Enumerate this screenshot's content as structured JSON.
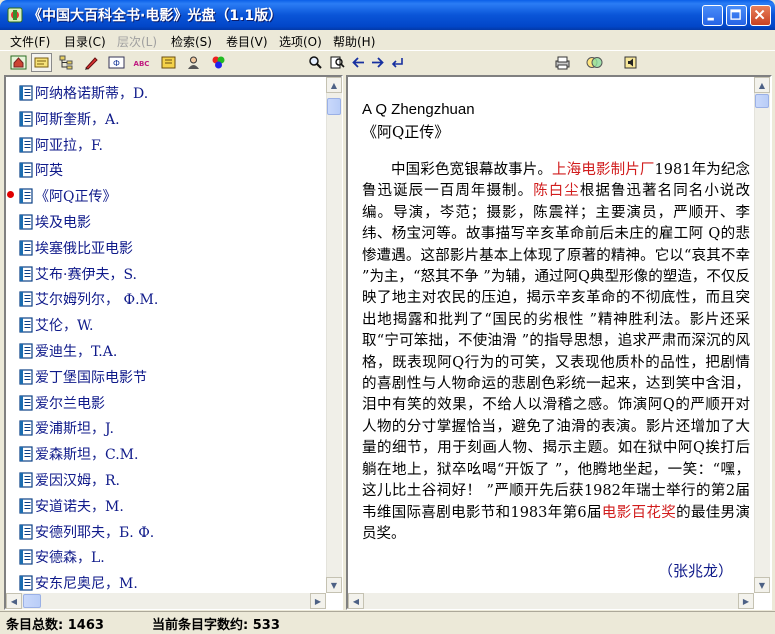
{
  "window": {
    "title": "《中国大百科全书·电影》光盘（1.1版）",
    "controls": {
      "minimize": "–",
      "maximize": "□",
      "close": "✕"
    }
  },
  "menu": [
    {
      "label": "文件(F)",
      "enabled": true
    },
    {
      "label": "目录(C)",
      "enabled": true
    },
    {
      "label": "层次(L)",
      "enabled": false
    },
    {
      "label": "检索(S)",
      "enabled": true
    },
    {
      "label": "卷目(V)",
      "enabled": true
    },
    {
      "label": "选项(O)",
      "enabled": true
    },
    {
      "label": "帮助(H)",
      "enabled": true
    }
  ],
  "toolbar": {
    "icons": [
      "home-icon",
      "index-card-icon",
      "tree-icon",
      "pen-icon",
      "code-icon",
      "abc-icon",
      "book-icon",
      "person-icon",
      "colors-icon",
      "search-icon",
      "search-doc-icon",
      "back-arrow-icon",
      "forward-arrow-icon",
      "return-icon",
      "print-icon",
      "copy-icon",
      "speaker-icon"
    ]
  },
  "entries": [
    "阿纳格诺斯蒂，D.",
    "阿斯奎斯，A.",
    "阿亚拉，F.",
    "阿英",
    "《阿Q正传》",
    "埃及电影",
    "埃塞俄比亚电影",
    "艾布·赛伊夫，S.",
    "艾尔姆列尔，  Ф.М.",
    "艾伦，W.",
    "爱迪生，T.A.",
    "爱丁堡国际电影节",
    "爱尔兰电影",
    "爱浦斯坦，J.",
    "爱森斯坦，C.M.",
    "爱因汉姆，R.",
    "安道诺夫，M.",
    "安德列耶夫，Б. Ф.",
    "安德森，L.",
    "安东尼奥尼，M."
  ],
  "selected_index": 4,
  "article": {
    "title_en": "A Q Zhengzhuan",
    "title_cn": "《阿Q正传》",
    "p1": "中国彩色宽银幕故事片。",
    "link1": "上海电影制片厂",
    "p2": "1981年为纪念鲁迅诞辰一百周年摄制。",
    "link2": "陈白尘",
    "p3": "根据鲁迅著名同名小说改编。导演，岑范；摄影，陈震祥；主要演员，严顺开、李纬、杨宝河等。故事描写辛亥革命前后未庄的雇工阿 Q的悲惨遭遇。这部影片基本上体现了原著的精神。它以“哀其不幸 ”为主，“怒其不争 ”为辅，通过阿Q典型形像的塑造，不仅反映了地主对农民的压迫，揭示辛亥革命的不彻底性，而且突出地揭露和批判了“国民的劣根性 ”精神胜利法。影片还采取“宁可笨拙，不使油滑 ”的指导思想，追求严肃而深沉的风格，既表现阿Q行为的可笑，又表现他质朴的品性，把剧情的喜剧性与人物命运的悲剧色彩统一起来，达到笑中含泪，泪中有笑的效果，不给人以滑稽之感。饰演阿Q的严顺开对人物的分寸掌握恰当，避免了油滑的表演。影片还增加了大量的细节，用于刻画人物、揭示主题。如在狱中阿Q挨打后躺在地上，狱卒吆喝“开饭了 ”，他腾地坐起，一笑：“嘿，这儿比土谷祠好！ ”严顺开先后获1982年瑞士举行的第2届韦维国际喜剧电影节和1983年第6届",
    "link3": "电影百花奖",
    "p4": "的最佳男演员奖。",
    "author": "（张兆龙）"
  },
  "status": {
    "total": "条目总数: 1463",
    "chars": "当前条目字数约: 533"
  }
}
